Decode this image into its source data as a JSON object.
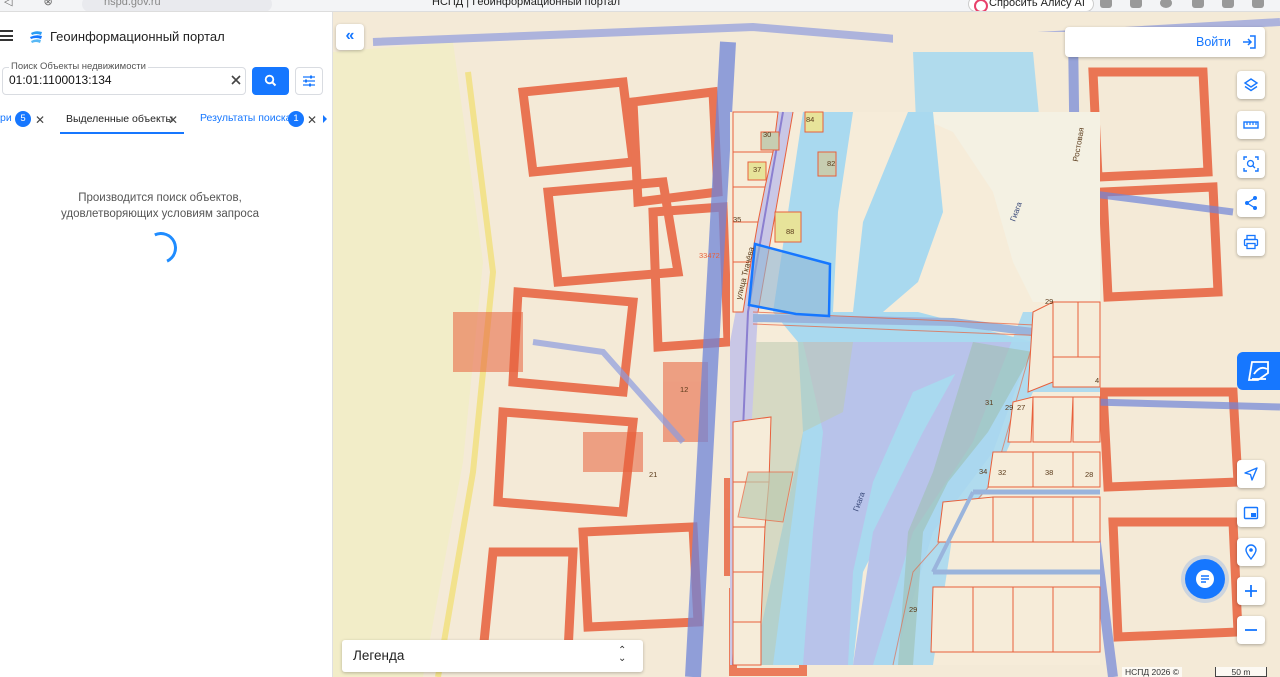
{
  "browser": {
    "url": "nspd.gov.ru",
    "tab_title": "НСПД | Геоинформационный портал",
    "assistant_label": "Спросить Алису AI"
  },
  "header": {
    "title": "Геоинформационный портал"
  },
  "search": {
    "legend": "Поиск Объекты недвижимости",
    "value": "01:01:1100013:134"
  },
  "tabs": {
    "first_fragment": "ри",
    "first_badge": "5",
    "selected_label": "Выделенные объекты",
    "results_label": "Результаты поиска",
    "results_badge": "1"
  },
  "status": {
    "loading_text_line1": "Производится поиск объектов,",
    "loading_text_line2": "удовлетворяющих условиям запроса"
  },
  "map": {
    "login_label": "Войти",
    "legend_label": "Легенда",
    "attribution": "НСПД 2026 ©",
    "scale_label": "50 m",
    "street_label": "улица Ткачёва",
    "street_label_2": "Ростовая",
    "river_label": "Гиага",
    "parcel_labels": [
      "30",
      "84",
      "82",
      "37",
      "35",
      "88",
      "33472",
      "29",
      "31",
      "29",
      "27",
      "34",
      "32",
      "38",
      "28",
      "29",
      "4",
      "21",
      "12"
    ],
    "colors": {
      "parcel_red": "#e8603c",
      "water": "#a9d9ef",
      "river": "#b8c3ea",
      "road_blue": "#6f84d8",
      "selection": "#1677ff"
    }
  },
  "icons": {
    "collapse": "chevrons-left-icon",
    "layers": "layers-icon",
    "ruler": "ruler-icon",
    "select_area": "select-area-icon",
    "share": "share-icon",
    "print": "print-icon",
    "locate": "locate-arrow-icon",
    "minimap": "minimap-icon",
    "geo": "geolocation-icon",
    "zoom_in": "plus-icon",
    "zoom_out": "minus-icon",
    "chat": "chat-icon"
  }
}
